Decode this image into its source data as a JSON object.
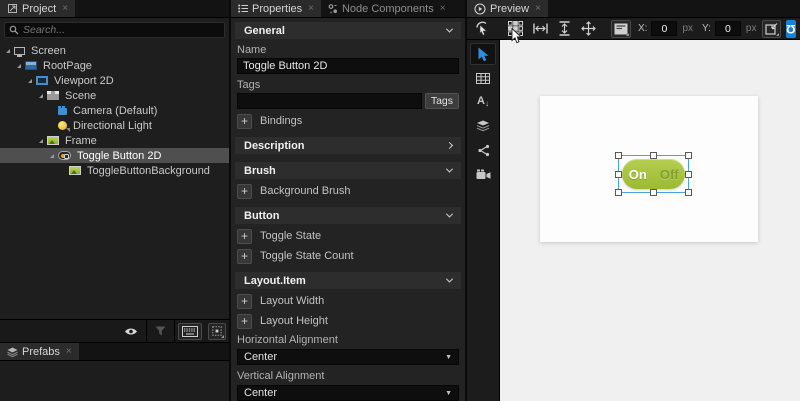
{
  "project_panel": {
    "tab_label": "Project",
    "search_placeholder": "Search...",
    "tree": [
      {
        "label": "Screen",
        "depth": 0,
        "icon": "screen",
        "expanded": true,
        "selected": false
      },
      {
        "label": "RootPage",
        "depth": 1,
        "icon": "rootpage",
        "expanded": true,
        "selected": false
      },
      {
        "label": "Viewport 2D",
        "depth": 2,
        "icon": "viewport",
        "expanded": true,
        "selected": false
      },
      {
        "label": "Scene",
        "depth": 3,
        "icon": "scene",
        "expanded": true,
        "selected": false
      },
      {
        "label": "Camera (Default)",
        "depth": 4,
        "icon": "camera",
        "expanded": null,
        "selected": false
      },
      {
        "label": "Directional Light",
        "depth": 4,
        "icon": "light",
        "expanded": null,
        "selected": false
      },
      {
        "label": "Frame",
        "depth": 3,
        "icon": "image",
        "expanded": true,
        "selected": false
      },
      {
        "label": "Toggle Button 2D",
        "depth": 4,
        "icon": "toggle",
        "expanded": true,
        "selected": true
      },
      {
        "label": "ToggleButtonBackground",
        "depth": 5,
        "icon": "image",
        "expanded": null,
        "selected": false
      }
    ],
    "footer_icon_names": [
      "visibility-eye-icon",
      "filter-icon",
      "virtual-keyboard-icon",
      "dock-options-icon"
    ],
    "prefabs_tab_label": "Prefabs"
  },
  "properties_panel": {
    "tabs": [
      {
        "label": "Properties",
        "active": true
      },
      {
        "label": "Node Components",
        "active": false
      }
    ],
    "rows": [
      {
        "type": "header",
        "label": "General",
        "chevron": "down"
      },
      {
        "type": "label",
        "label": "Name"
      },
      {
        "type": "input",
        "value": "Toggle Button 2D",
        "name": "name-input"
      },
      {
        "type": "label",
        "label": "Tags"
      },
      {
        "type": "tags",
        "value": "",
        "button": "Tags",
        "name": "tags-input"
      },
      {
        "type": "plus",
        "label": "Bindings"
      },
      {
        "type": "header",
        "label": "Description",
        "chevron": "right"
      },
      {
        "type": "header",
        "label": "Brush",
        "chevron": "down"
      },
      {
        "type": "plus",
        "label": "Background Brush"
      },
      {
        "type": "header",
        "label": "Button",
        "chevron": "down"
      },
      {
        "type": "plus",
        "label": "Toggle State"
      },
      {
        "type": "plus",
        "label": "Toggle State Count"
      },
      {
        "type": "header",
        "label": "Layout.Item",
        "chevron": "down"
      },
      {
        "type": "plus",
        "label": "Layout Width"
      },
      {
        "type": "plus",
        "label": "Layout Height"
      },
      {
        "type": "label",
        "label": "Horizontal Alignment"
      },
      {
        "type": "select",
        "value": "Center",
        "name": "horizontal-alignment-select"
      },
      {
        "type": "label",
        "label": "Vertical Alignment"
      },
      {
        "type": "select",
        "value": "Center",
        "name": "vertical-alignment-select"
      }
    ]
  },
  "preview_panel": {
    "tab_label": "Preview",
    "toolbar": {
      "x_label": "X:",
      "x_value": "0",
      "x_unit": "px",
      "y_label": "Y:",
      "y_value": "0",
      "y_unit": "px"
    },
    "side_tool_names": [
      "select-arrow-tool",
      "table-tool",
      "text-tool",
      "layers-tool",
      "node-connections-tool",
      "camera-tool"
    ],
    "canvas": {
      "toggle_on_label": "On",
      "toggle_off_label": "Off"
    }
  },
  "colors": {
    "accent_blue": "#1583d7",
    "selection_blue": "#4aa3e8",
    "toggle_green": "#a5c13c",
    "toggle_off_text": "#83a02c"
  }
}
